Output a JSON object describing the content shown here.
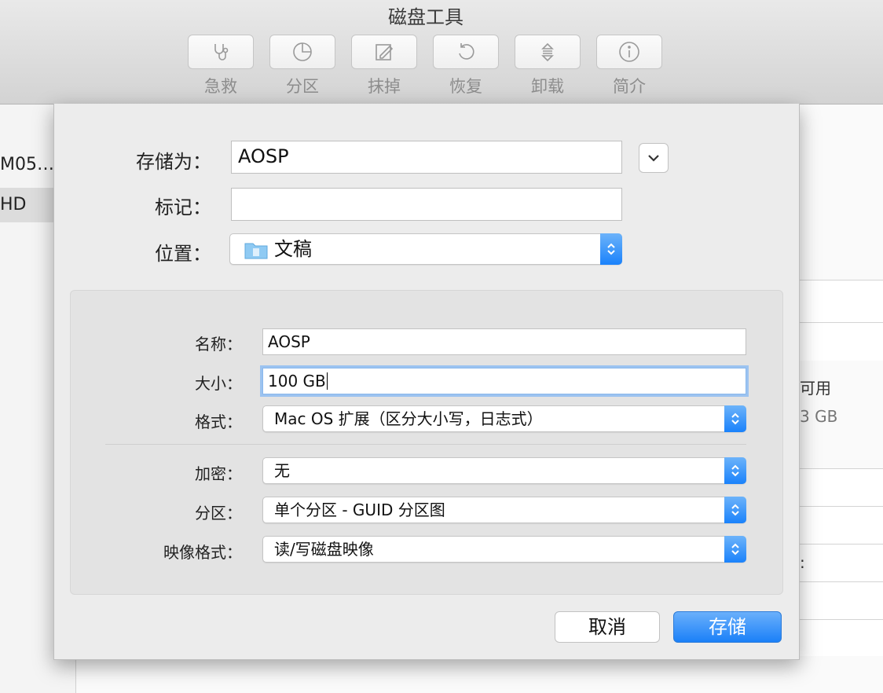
{
  "window": {
    "title": "磁盘工具"
  },
  "toolbar": {
    "items": [
      {
        "label": "急救",
        "icon": "stethoscope-icon"
      },
      {
        "label": "分区",
        "icon": "pie-chart-icon"
      },
      {
        "label": "抹掉",
        "icon": "erase-icon"
      },
      {
        "label": "恢复",
        "icon": "restore-icon"
      },
      {
        "label": "卸载",
        "icon": "unmount-icon"
      },
      {
        "label": "简介",
        "icon": "info-icon"
      }
    ]
  },
  "sidebar": {
    "items": [
      {
        "label": "M05…"
      },
      {
        "label": "HD"
      }
    ]
  },
  "background": {
    "available_label": "可用",
    "capacity_value": "3 GB",
    "colon": ":"
  },
  "dialog": {
    "save_as": {
      "label": "存储为：",
      "value": "AOSP"
    },
    "tags": {
      "label": "标记：",
      "value": ""
    },
    "location": {
      "label": "位置：",
      "value": "文稿",
      "icon": "folder-icon"
    },
    "name": {
      "label": "名称：",
      "value": "AOSP"
    },
    "size": {
      "label": "大小：",
      "value": "100 GB"
    },
    "format": {
      "label": "格式：",
      "value": "Mac OS 扩展（区分大小写，日志式）"
    },
    "encryption": {
      "label": "加密：",
      "value": "无"
    },
    "partition": {
      "label": "分区：",
      "value": "单个分区 - GUID 分区图"
    },
    "image_format": {
      "label": "映像格式：",
      "value": "读/写磁盘映像"
    },
    "cancel_label": "取消",
    "save_label": "存储"
  },
  "colors": {
    "accent": "#1b80f8",
    "focus_ring": "#9cc3f0"
  }
}
